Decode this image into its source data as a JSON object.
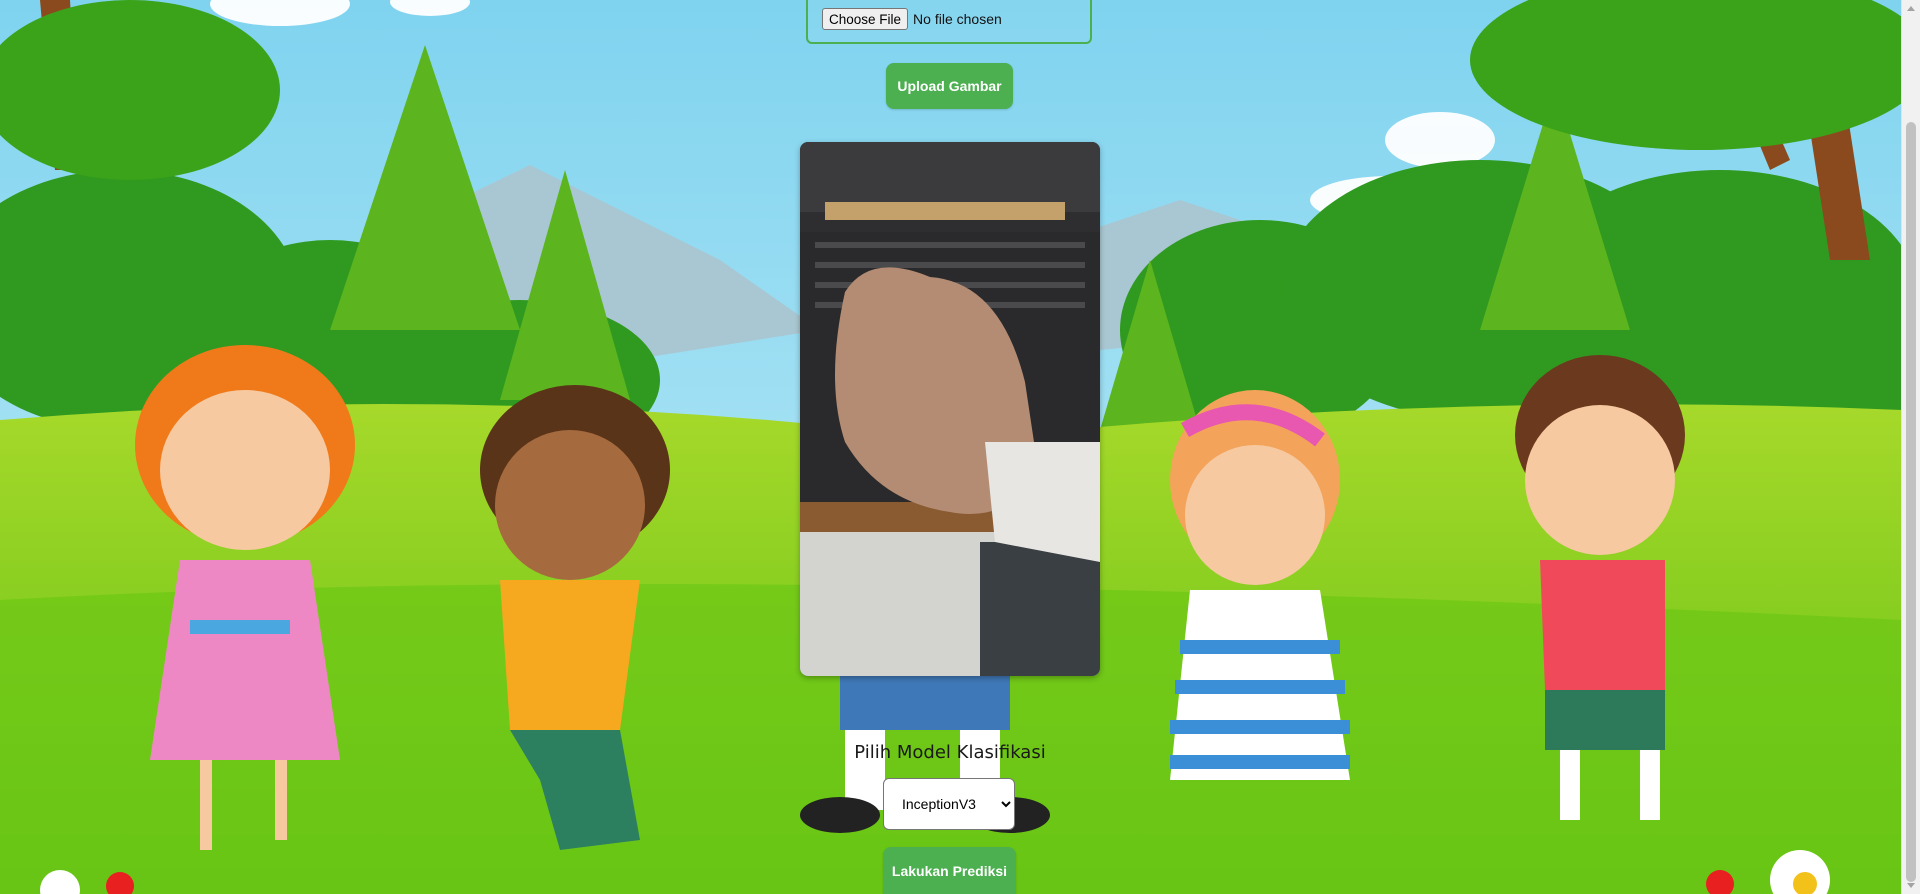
{
  "upload_form": {
    "choose_file_label": "Choose File",
    "file_status": "No file chosen",
    "upload_button": "Upload Gambar"
  },
  "preview": {
    "alt": "Uploaded image preview"
  },
  "model": {
    "label": "Pilih Model Klasifikasi",
    "selected": "InceptionV3"
  },
  "predict_button": "Lakukan Prediksi",
  "colors": {
    "accent_green": "#4caf50",
    "sky": "#88d8f0",
    "grass": "#7ccb1e"
  },
  "icons": [
    "dropdown-chevron-icon",
    "scroll-up-arrow-icon",
    "scroll-down-arrow-icon"
  ]
}
